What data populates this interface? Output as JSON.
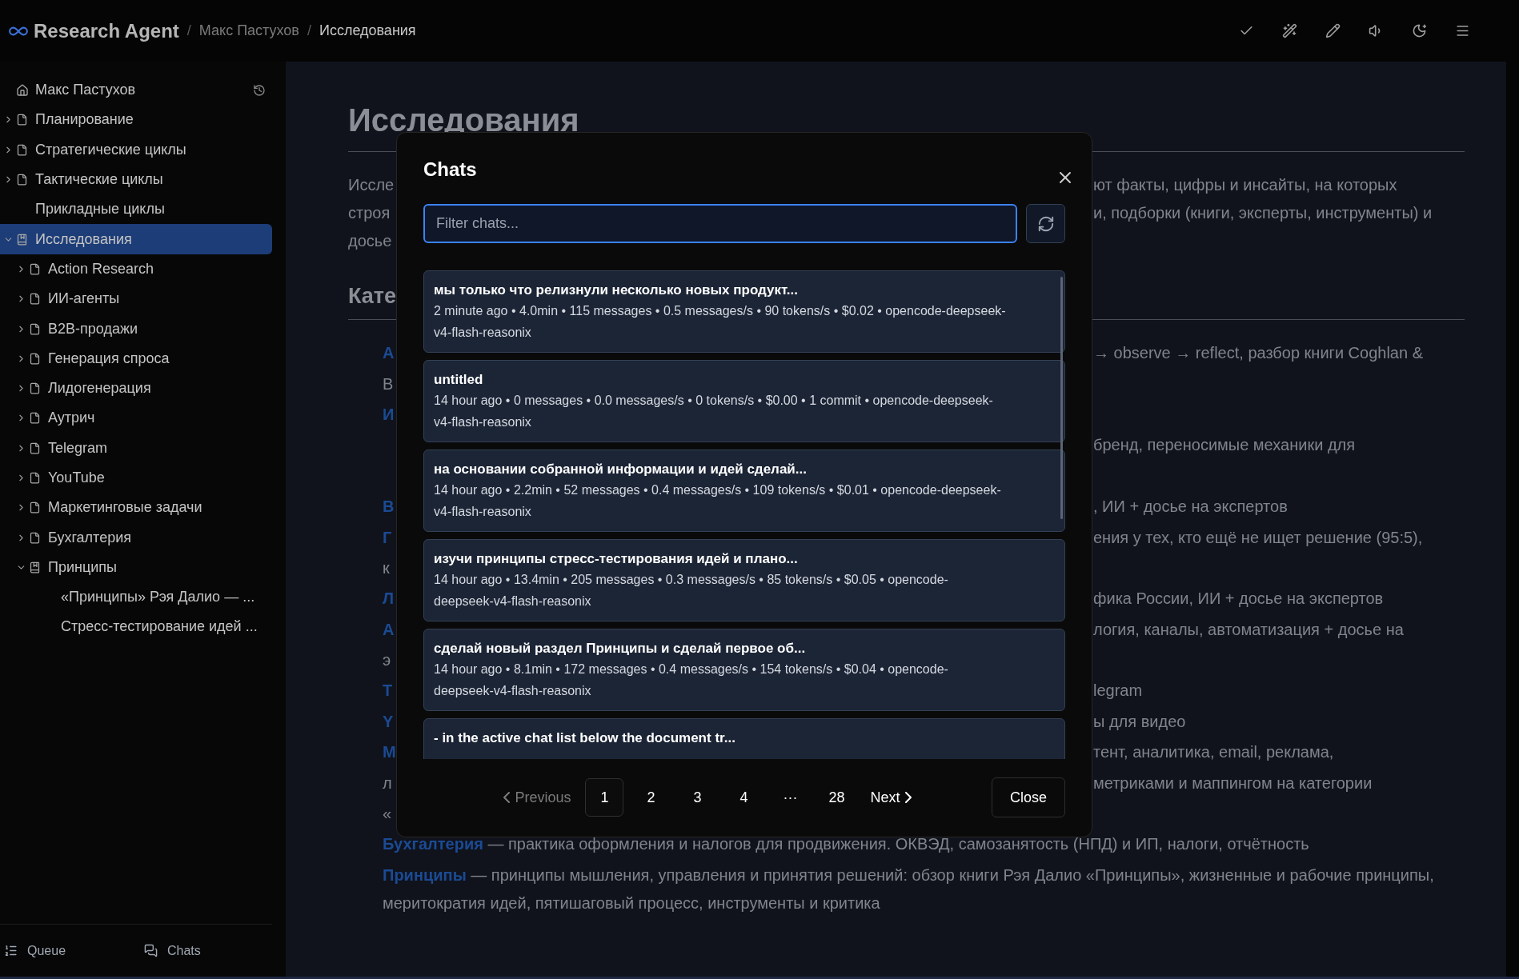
{
  "top_bar": {
    "app_name": "Research Agent",
    "breadcrumbs": [
      {
        "separator": "/",
        "label": "Макс Пастухов",
        "current": false
      },
      {
        "separator": "/",
        "label": "Исследования",
        "current": true
      }
    ]
  },
  "sidebar": {
    "home": {
      "label": "Макс Пастухов"
    },
    "tree": [
      {
        "label": "Планирование",
        "kind": "page",
        "expanded": false,
        "selected": false
      },
      {
        "label": "Стратегические циклы",
        "kind": "page",
        "expanded": false,
        "selected": false
      },
      {
        "label": "Тактические циклы",
        "kind": "page",
        "expanded": false,
        "selected": false
      },
      {
        "label": "Прикладные циклы",
        "kind": "plain",
        "selected": false
      },
      {
        "label": "Исследования",
        "kind": "page",
        "expanded": true,
        "selected": true,
        "children": [
          {
            "label": "Action Research",
            "kind": "page",
            "expanded": false,
            "selected": false
          },
          {
            "label": "ИИ-агенты",
            "kind": "page",
            "expanded": false,
            "selected": false
          },
          {
            "label": "B2B-продажи",
            "kind": "page",
            "expanded": false,
            "selected": false
          },
          {
            "label": "Генерация спроса",
            "kind": "page",
            "expanded": false,
            "selected": false
          },
          {
            "label": "Лидогенерация",
            "kind": "page",
            "expanded": false,
            "selected": false
          },
          {
            "label": "Аутрич",
            "kind": "page",
            "expanded": false,
            "selected": false
          },
          {
            "label": "Telegram",
            "kind": "page",
            "expanded": false,
            "selected": false
          },
          {
            "label": "YouTube",
            "kind": "page",
            "expanded": false,
            "selected": false
          },
          {
            "label": "Маркетинговые задачи",
            "kind": "page",
            "expanded": false,
            "selected": false
          },
          {
            "label": "Бухгалтерия",
            "kind": "page",
            "expanded": false,
            "selected": false
          },
          {
            "label": "Принципы",
            "kind": "page",
            "expanded": true,
            "selected": false,
            "children": [
              {
                "label": "«Принципы» Рэя Далио — ...",
                "kind": "plain",
                "selected": false
              },
              {
                "label": "Стресс-тестирование идей ...",
                "kind": "plain",
                "selected": false
              }
            ]
          }
        ]
      }
    ],
    "footer": [
      {
        "label": "Queue",
        "kind": "queue"
      },
      {
        "label": "Chats",
        "kind": "chats"
      }
    ]
  },
  "main": {
    "title": "Исследования",
    "intro_lines": [
      {
        "left": "Иссле",
        "right": "ют факты, цифры и инсайты, на которых"
      },
      {
        "left": "строя",
        "right": "и, подборки (книги, эксперты, инструменты) и"
      },
      {
        "left": "досье"
      }
    ],
    "section_title": "Кате",
    "list_rows": [
      {
        "kind": "line",
        "left": {
          "text": "А",
          "kind": "link"
        },
        "right": "→ observe → reflect, разбор книги Coghlan &"
      },
      {
        "kind": "line",
        "left": {
          "text": "B",
          "kind": "text"
        }
      },
      {
        "kind": "line",
        "left": {
          "text": "И",
          "kind": "link"
        }
      },
      {
        "kind": "line",
        "right": "бренд, переносимые механики для"
      },
      {
        "kind": "blank"
      },
      {
        "kind": "line",
        "left": {
          "text": "B",
          "kind": "link"
        },
        "right": ", ИИ + досье на экспертов"
      },
      {
        "kind": "line",
        "left": {
          "text": "Г",
          "kind": "link"
        },
        "right": "ения у тех, кто ещё не ищет решение (95:5),"
      },
      {
        "kind": "line",
        "left": {
          "text": "к",
          "kind": "text"
        }
      },
      {
        "kind": "line",
        "left": {
          "text": "Л",
          "kind": "link"
        },
        "right": "фика России, ИИ + досье на экспертов"
      },
      {
        "kind": "line",
        "left": {
          "text": "А",
          "kind": "link"
        },
        "right": "логия, каналы, автоматизация + досье на"
      },
      {
        "kind": "line",
        "left": {
          "text": "э",
          "kind": "text"
        }
      },
      {
        "kind": "line",
        "left": {
          "text": "Т",
          "kind": "link"
        },
        "right": "legram"
      },
      {
        "kind": "line",
        "left": {
          "text": "Y",
          "kind": "link"
        },
        "right": "ы для видео"
      },
      {
        "kind": "line",
        "left": {
          "text": "М",
          "kind": "link"
        },
        "right": "тент, аналитика, email, реклама,"
      },
      {
        "kind": "line",
        "left": {
          "text": "л",
          "kind": "text"
        },
        "right": "метриками и маппингом на категории"
      },
      {
        "kind": "line",
        "left": {
          "text": "«",
          "kind": "text"
        }
      }
    ],
    "items": [
      {
        "link": "Бухгалтерия",
        "text": " — практика оформления и налогов для продвижения. ОКВЭД, самозанятость (НПД) и ИП, налоги, отчётность"
      },
      {
        "link": "Принципы",
        "text": " — принципы мышления, управления и принятия решений: обзор книги Рэя Далио «Принципы», жизненные и рабочие принципы, меритократия идей, пятишаговый процесс, инструменты и критика"
      }
    ]
  },
  "modal": {
    "title": "Chats",
    "filter": {
      "placeholder": "Filter chats..."
    },
    "chats": [
      {
        "title": "мы только что релизнули несколько новых продукт...",
        "meta": "2 minute ago • 4.0min • 115 messages • 0.5 messages/s • 90 tokens/s • $0.02 • opencode-deepseek-v4-flash-reasonix"
      },
      {
        "title": "untitled",
        "meta": "14 hour ago • 0 messages • 0.0 messages/s • 0 tokens/s • $0.00 • 1 commit • opencode-deepseek-v4-flash-reasonix"
      },
      {
        "title": "на основании собранной информации и идей сделай...",
        "meta": "14 hour ago • 2.2min • 52 messages • 0.4 messages/s • 109 tokens/s • $0.01 • opencode-deepseek-v4-flash-reasonix"
      },
      {
        "title": "изучи принципы стресс-тестирования идей и плано...",
        "meta": "14 hour ago • 13.4min • 205 messages • 0.3 messages/s • 85 tokens/s • $0.05 • opencode-deepseek-v4-flash-reasonix"
      },
      {
        "title": "сделай новый раздел Принципы и сделай первое об...",
        "meta": "14 hour ago • 8.1min • 172 messages • 0.4 messages/s • 154 tokens/s • $0.04 • opencode-deepseek-v4-flash-reasonix"
      },
      {
        "title": "- in the active chat list below the document tr..."
      }
    ],
    "pagination": {
      "previous": {
        "label": "Previous",
        "disabled": true
      },
      "pages": [
        {
          "label": "1",
          "selected": true
        },
        {
          "label": "2",
          "selected": false
        },
        {
          "label": "3",
          "selected": false
        },
        {
          "label": "4",
          "selected": false
        },
        {
          "label": "···",
          "selected": false
        },
        {
          "label": "28",
          "selected": false
        }
      ],
      "next": {
        "label": "Next",
        "disabled": false
      }
    },
    "close_label": "Close"
  }
}
